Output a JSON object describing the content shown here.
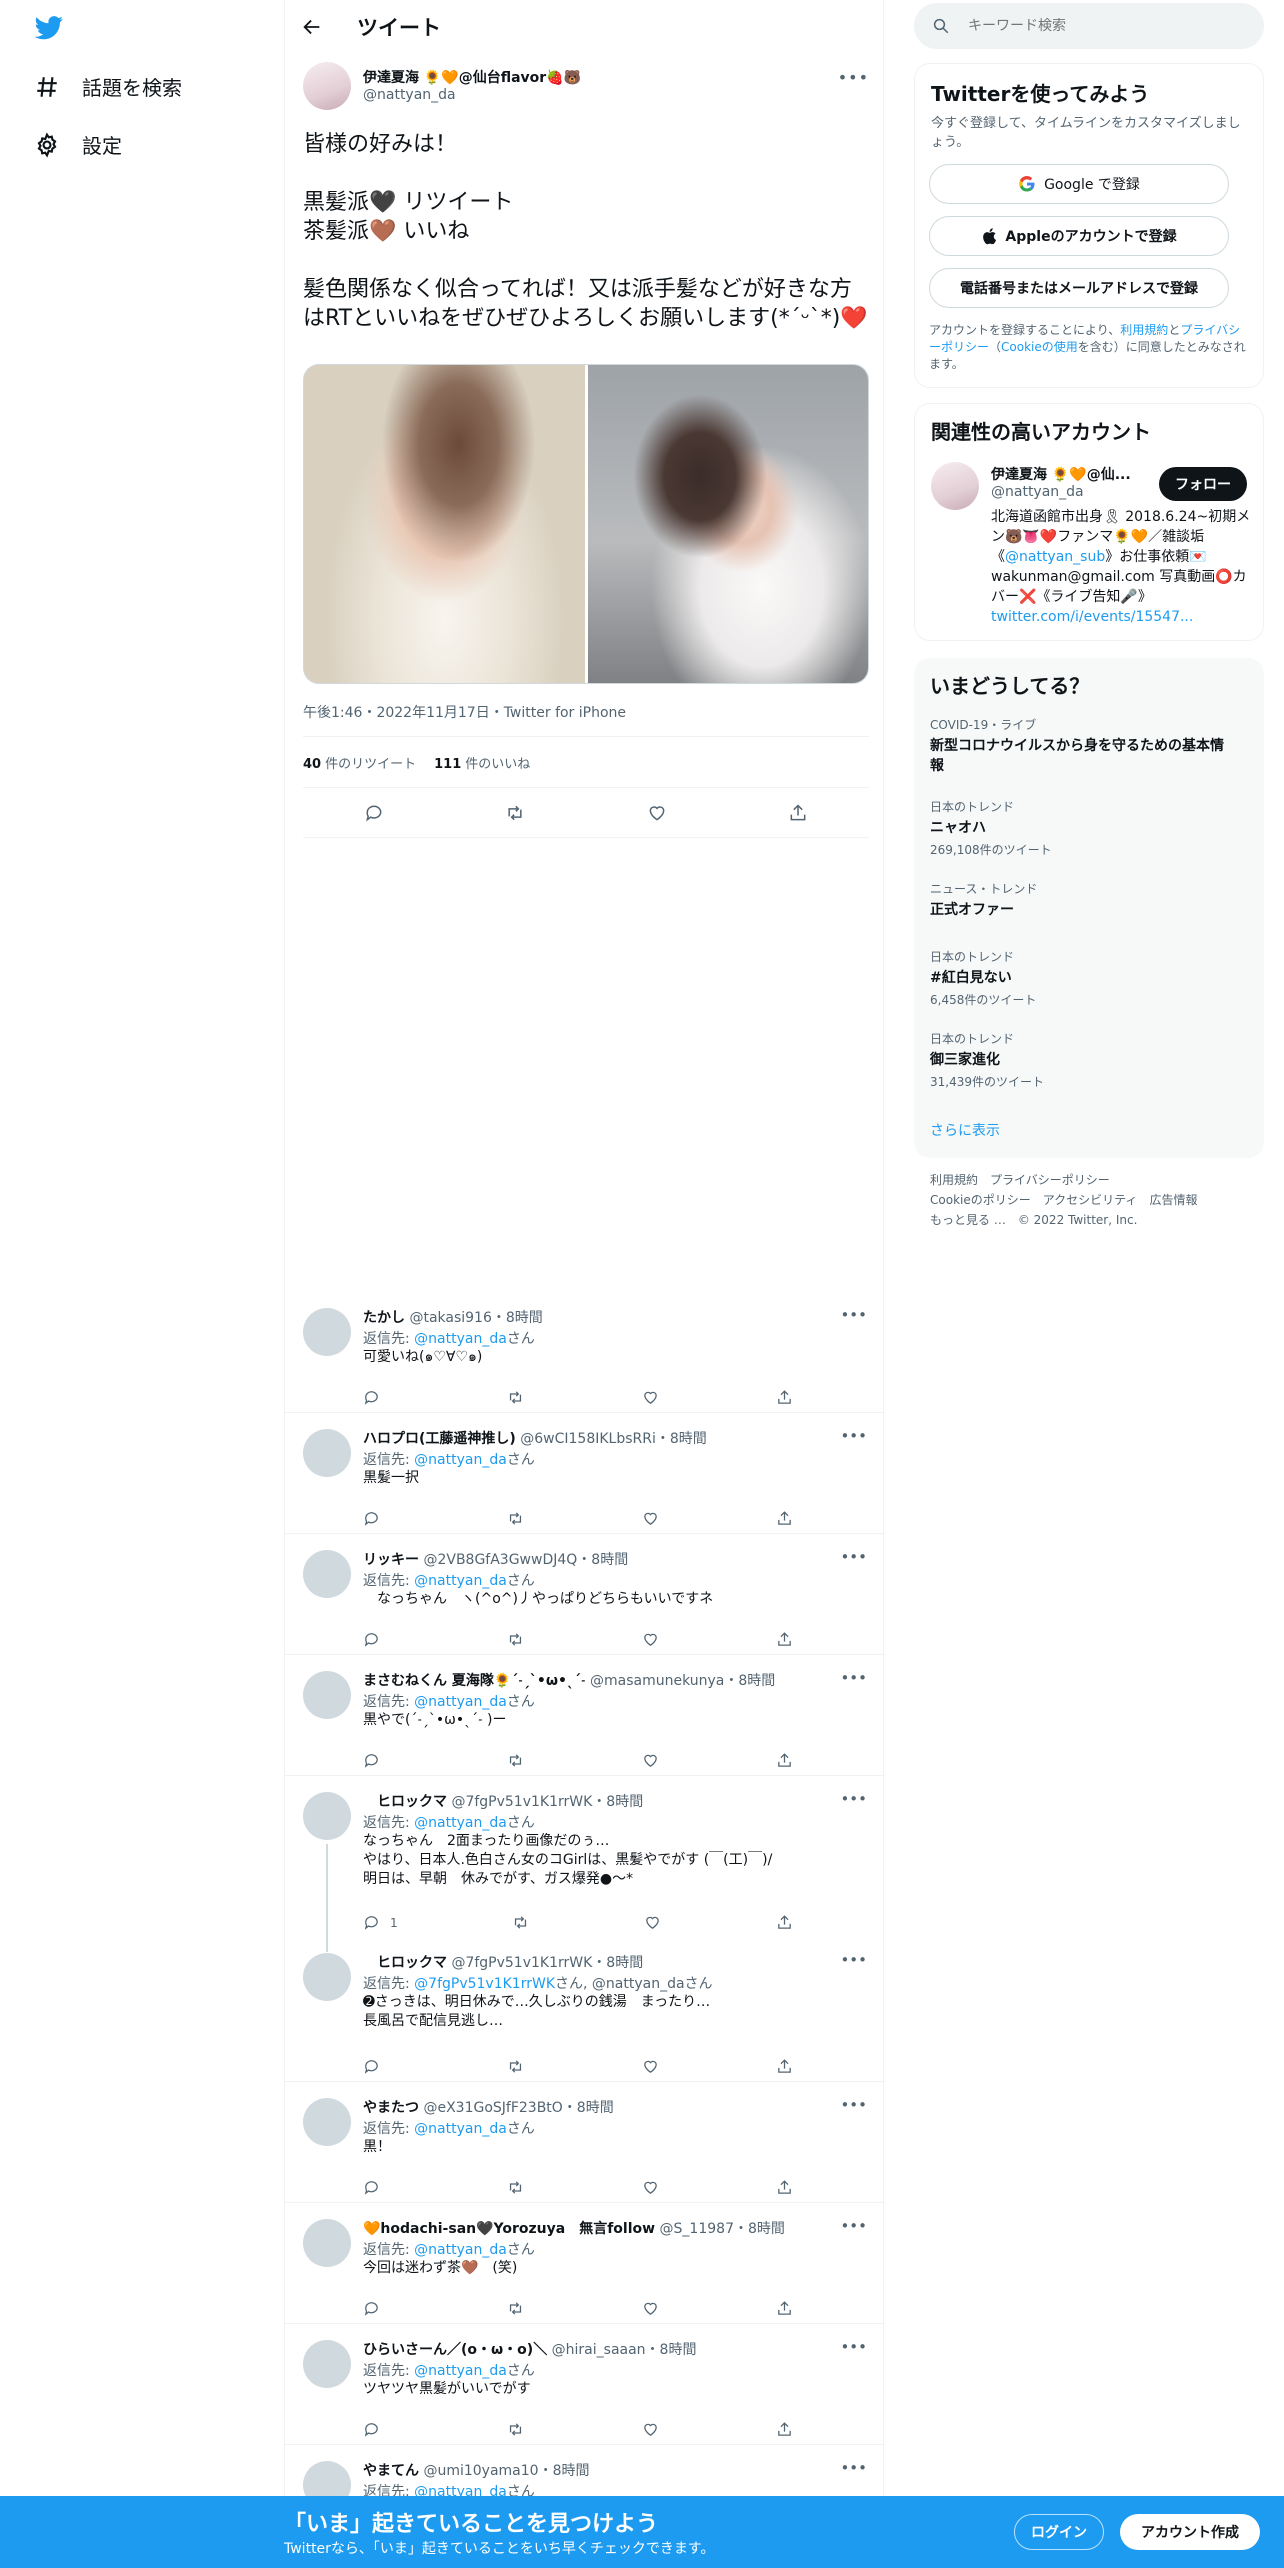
{
  "nav": {
    "explore_label": "話題を検索",
    "settings_label": "設定"
  },
  "header": {
    "title": "ツイート"
  },
  "tweet": {
    "name": "伊達夏海 🌻🧡@仙台flavor🍓🐻",
    "handle": "@nattyan_da",
    "text": "皆様の好みは！\n\n黒髪派🖤 リツイート\n茶髪派🤎 いいね\n\n髪色関係なく似合ってれば！又は派手髪などが好きな方はRTといいねをぜひぜひよろしくお願いします(*ˊᵕˋ*)❤️",
    "meta": "午後1:46・2022年11月17日・Twitter for iPhone",
    "retweet_count": "40",
    "retweet_label": "件のリツイート",
    "like_count": "111",
    "like_label": "件のいいね"
  },
  "replies": [
    {
      "name": "たかし",
      "meta": "@takasi916・8時間",
      "to_prefix": "返信先: ",
      "to": "@nattyan_da",
      "to_suffix": "さん",
      "text": "可愛いね(๑♡∀♡๑)",
      "reply_count": ""
    },
    {
      "name": "ハロプロ(工藤遥神推し)",
      "meta": "@6wCI158IKLbsRRi・8時間",
      "to_prefix": "返信先: ",
      "to": "@nattyan_da",
      "to_suffix": "さん",
      "text": "黒髪一択",
      "reply_count": ""
    },
    {
      "name": "リッキー",
      "meta": "@2VB8GfA3GwwDJ4Q・8時間",
      "to_prefix": "返信先: ",
      "to": "@nattyan_da",
      "to_suffix": "さん",
      "text": "　なっちゃん　ヽ(^o^)丿やっぱりどちらもいいですネ",
      "reply_count": ""
    },
    {
      "name": "まさむねくん 夏海隊🌻ˊ˗ˏˋ•ω•ˎˊ˗",
      "meta": "@masamunekunya・8時間",
      "to_prefix": "返信先: ",
      "to": "@nattyan_da",
      "to_suffix": "さん",
      "text": "黒やで(ˊ˗ˏˋ•ω•ˎˊ˗ )ー",
      "reply_count": ""
    },
    {
      "name": "　ヒロックマ",
      "meta": "@7fgPv51v1K1rrWK・8時間",
      "to_prefix": "返信先: ",
      "to": "@nattyan_da",
      "to_suffix": "さん",
      "text": "なっちゃん　2面まったり画像だのぅ…\nやはり、日本人.色白さん女のコGirlは、黒髪やでがす (￣(工)￣)/\n明日は、早朝　休みでがす、ガス爆発●～*",
      "reply_count": "1"
    },
    {
      "name": "　ヒロックマ",
      "meta": "@7fgPv51v1K1rrWK・8時間",
      "to_prefix": "返信先: ",
      "to": "@7fgPv51v1K1rrWK",
      "to_suffix": "さん, @nattyan_daさん",
      "text": "➋さっきは、明日休みで…久しぶりの銭湯　まったり…\n長風呂で配信見逃し…",
      "reply_count": ""
    },
    {
      "name": "やまたつ",
      "meta": "@eX31GoSJfF23BtO・8時間",
      "to_prefix": "返信先: ",
      "to": "@nattyan_da",
      "to_suffix": "さん",
      "text": "黒！",
      "reply_count": ""
    },
    {
      "name": "🧡hodachi-san🖤Yorozuya　無言follow",
      "meta": "@S_11987・8時間",
      "to_prefix": "返信先: ",
      "to": "@nattyan_da",
      "to_suffix": "さん",
      "text": "今回は迷わず茶🤎　(笑)",
      "reply_count": ""
    },
    {
      "name": "ひらいさーん／(o・ω・o)＼",
      "meta": "@hirai_saaan・8時間",
      "to_prefix": "返信先: ",
      "to": "@nattyan_da",
      "to_suffix": "さん",
      "text": "ツヤツヤ黒髪がいいでがす",
      "reply_count": ""
    },
    {
      "name": "やまてん",
      "meta": "@umi10yama10・8時間",
      "to_prefix": "返信先: ",
      "to": "@nattyan_da",
      "to_suffix": "さん",
      "text": "",
      "reply_count": ""
    }
  ],
  "search": {
    "placeholder": "キーワード検索"
  },
  "signup": {
    "title": "Twitterを使ってみよう",
    "subtitle": "今すぐ登録して、タイムラインをカスタマイズしましょう。",
    "google_btn": "Google で登録",
    "apple_btn": "Appleのアカウントで登録",
    "phone_btn": "電話番号またはメールアドレスで登録",
    "legal_1": "アカウントを登録することにより、",
    "legal_link1": "利用規約",
    "legal_2": "と",
    "legal_link2": "プライバシーポリシー",
    "legal_3": "（",
    "legal_link3": "Cookieの使用",
    "legal_4": "を含む）に同意したとみなされます。"
  },
  "related": {
    "title": "関連性の高いアカウント",
    "name": "伊達夏海 🌻🧡@仙...",
    "handle": "@nattyan_da",
    "follow_label": "フォロー",
    "bio_1": "北海道函館市出身🎗 2018.6.24~初期メン🐻👅❤️ファンマ🌻🧡／雑談垢《",
    "bio_link1": "@nattyan_sub",
    "bio_2": "》お仕事依頼💌wakunman@gmail.com 写真動画⭕カバー❌《ライブ告知🎤》",
    "bio_link2": "twitter.com/i/events/15547..."
  },
  "trends": {
    "title": "いまどうしてる？",
    "items": [
      {
        "category": "COVID-19・ライブ",
        "name": "新型コロナウイルスから身を守るための基本情報",
        "count": ""
      },
      {
        "category": "日本のトレンド",
        "name": "ニャオハ",
        "count": "269,108件のツイート"
      },
      {
        "category": "ニュース・トレンド",
        "name": "正式オファー",
        "count": ""
      },
      {
        "category": "日本のトレンド",
        "name": "#紅白見ない",
        "count": "6,458件のツイート"
      },
      {
        "category": "日本のトレンド",
        "name": "御三家進化",
        "count": "31,439件のツイート"
      }
    ],
    "more": "さらに表示"
  },
  "footer": {
    "terms": "利用規約",
    "privacy": "プライバシーポリシー",
    "cookie": "Cookieのポリシー",
    "accessibility": "アクセシビリティ",
    "ads": "広告情報",
    "more": "もっと見る …",
    "copyright": "© 2022 Twitter, Inc."
  },
  "bottombar": {
    "title": "「いま」起きていることを見つけよう",
    "subtitle": "Twitterなら、「いま」起きていることをいち早くチェックできます。",
    "login": "ログイン",
    "signup": "アカウント作成"
  },
  "colors": {
    "accent": "#1d9bf0",
    "text": "#0f1419",
    "muted": "#536471"
  }
}
